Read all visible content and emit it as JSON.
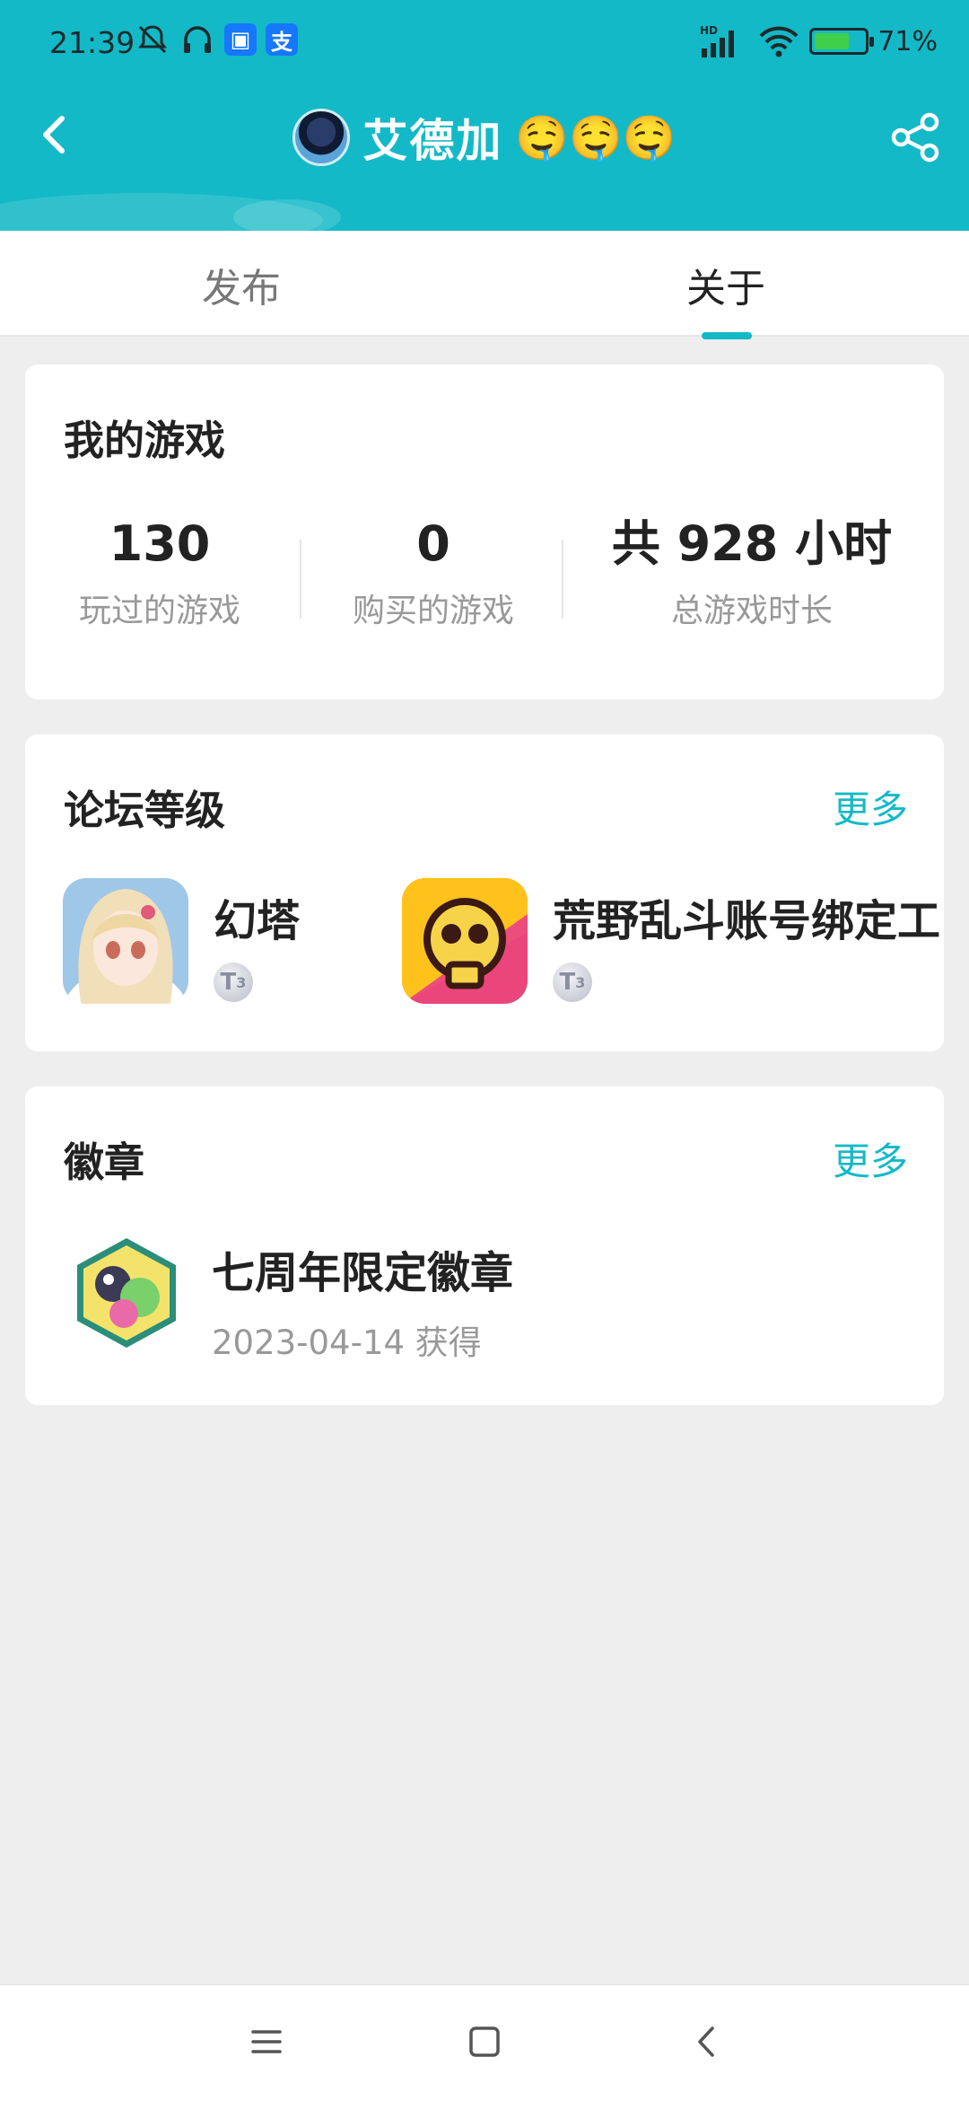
{
  "status_bar": {
    "time": "21:39",
    "network": "HD",
    "battery_percent": "71%",
    "battery_level": 0.71,
    "app_badges": [
      "支"
    ]
  },
  "header": {
    "username": "艾德加",
    "emojis": "🤤🤤🤤",
    "back_icon": "chevron-left-icon",
    "share_icon": "share-icon"
  },
  "tabs": [
    {
      "label": "发布",
      "active": false
    },
    {
      "label": "关于",
      "active": true
    }
  ],
  "my_games": {
    "title": "我的游戏",
    "stats": [
      {
        "value": "130",
        "label": "玩过的游戏"
      },
      {
        "value": "0",
        "label": "购买的游戏"
      },
      {
        "value": "共 928 小时",
        "label": "总游戏时长"
      }
    ]
  },
  "forum_levels": {
    "title": "论坛等级",
    "more": "更多",
    "items": [
      {
        "name": "幻塔",
        "level": "T",
        "level_num": "3"
      },
      {
        "name": "荒野乱斗账号绑定工",
        "level": "T",
        "level_num": "3"
      }
    ]
  },
  "badges": {
    "title": "徽章",
    "more": "更多",
    "items": [
      {
        "name": "七周年限定徽章",
        "date": "2023-04-14 获得"
      }
    ]
  },
  "colors": {
    "accent": "#14b9c7",
    "background": "#eeeeee"
  }
}
